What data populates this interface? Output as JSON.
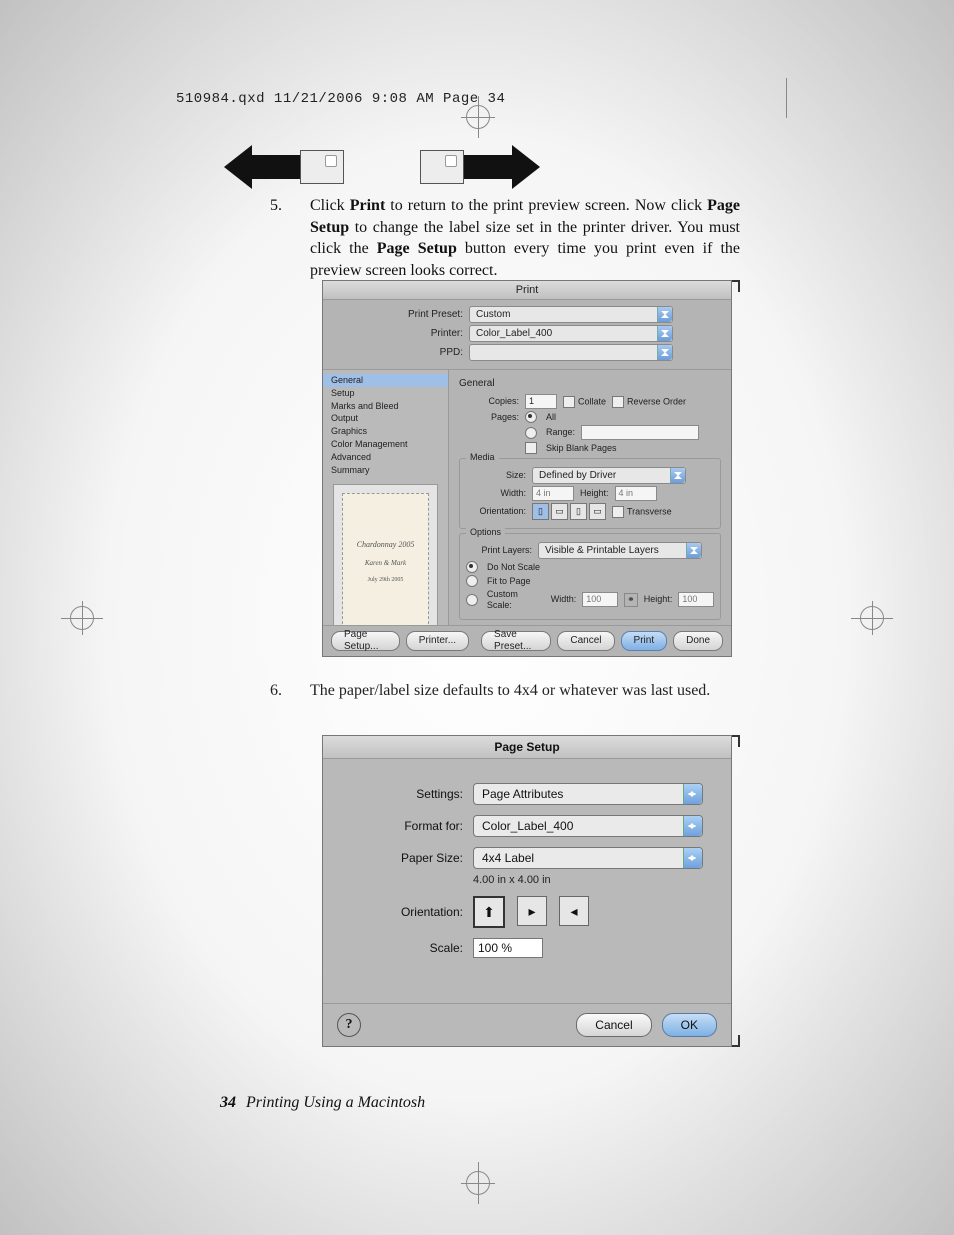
{
  "header_slug": "510984.qxd  11/21/2006  9:08 AM  Page 34",
  "step5": {
    "num": "5.",
    "text_parts": {
      "a": "Click ",
      "b_print": "Print",
      "c": " to return to the print preview screen. Now click ",
      "b_pagesetup": "Page Setup",
      "d": " to change the label size set in the printer driver. You must click the ",
      "b_pagesetup2": "Page Setup",
      "e": " button every time you print even if the preview screen looks correct."
    }
  },
  "print_dialog": {
    "title": "Print",
    "labels": {
      "preset": "Print Preset:",
      "printer": "Printer:",
      "ppd": "PPD:",
      "copies": "Copies:",
      "collate": "Collate",
      "reverse": "Reverse Order",
      "pages": "Pages:",
      "all": "All",
      "range": "Range:",
      "skip": "Skip Blank Pages",
      "media": "Media",
      "size": "Size:",
      "width": "Width:",
      "height": "Height:",
      "orientation": "Orientation:",
      "transverse": "Transverse",
      "options": "Options",
      "print_layers": "Print Layers:",
      "do_not_scale": "Do Not Scale",
      "fit": "Fit to Page",
      "custom_scale": "Custom Scale:",
      "general": "General"
    },
    "values": {
      "preset": "Custom",
      "printer": "Color_Label_400",
      "ppd": "",
      "copies": "1",
      "size": "Defined by Driver",
      "width": "4 in",
      "height": "4 in",
      "print_layers": "Visible & Printable Layers",
      "cs_width": "100",
      "cs_height": "100"
    },
    "sidebar": [
      "General",
      "Setup",
      "Marks and Bleed",
      "Output",
      "Graphics",
      "Color Management",
      "Advanced",
      "Summary"
    ],
    "thumb": {
      "line1": "Chardonnay 2005",
      "line2": "Karen & Mark",
      "line3": "July 29th 2005"
    },
    "buttons": {
      "page_setup": "Page Setup...",
      "printer_btn": "Printer...",
      "save_preset": "Save Preset...",
      "cancel": "Cancel",
      "print": "Print",
      "done": "Done"
    }
  },
  "step6": {
    "num": "6.",
    "text": "The paper/label size defaults to 4x4 or whatever was last used."
  },
  "page_setup": {
    "title": "Page Setup",
    "labels": {
      "settings": "Settings:",
      "format_for": "Format for:",
      "paper_size": "Paper Size:",
      "orientation": "Orientation:",
      "scale": "Scale:"
    },
    "values": {
      "settings": "Page Attributes",
      "format_for": "Color_Label_400",
      "paper_size": "4x4 Label",
      "paper_size_sub": "4.00 in x 4.00 in",
      "scale": "100 %"
    },
    "buttons": {
      "help": "?",
      "cancel": "Cancel",
      "ok": "OK"
    }
  },
  "footer": {
    "page": "34",
    "text": "Printing Using a Macintosh"
  }
}
